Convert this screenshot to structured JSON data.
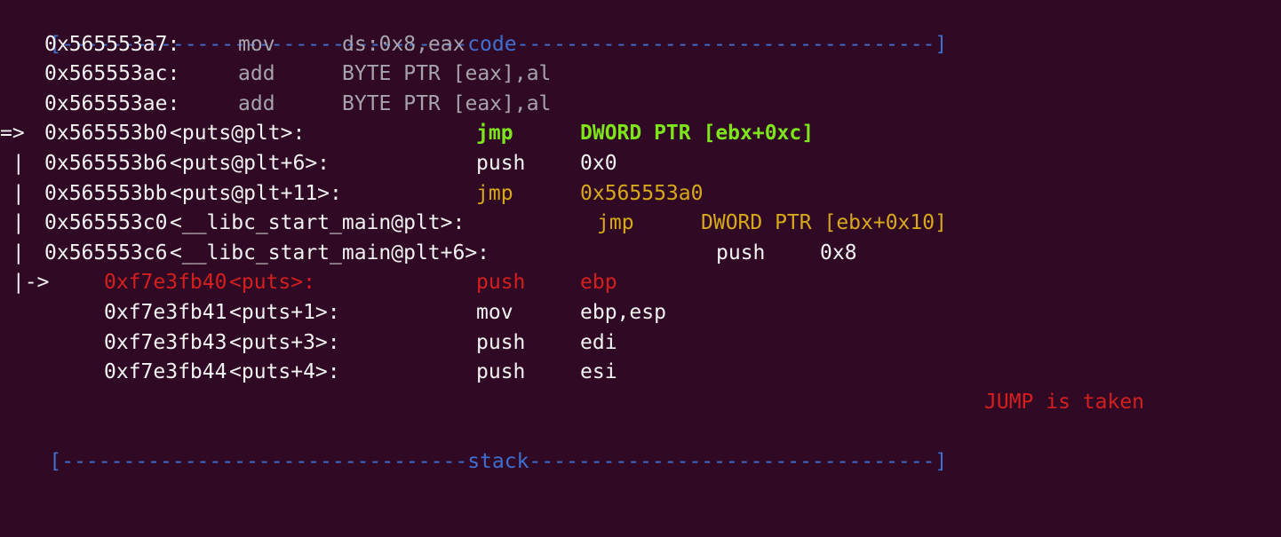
{
  "header": {
    "code_rule": "[---------------------------------code----------------------------------]",
    "stack_rule": "[---------------------------------stack---------------------------------]"
  },
  "prev_lines": [
    {
      "addr": "0x565553a7:",
      "mnemonic": "mov",
      "operands": "ds:0x8,eax"
    },
    {
      "addr": "0x565553ac:",
      "mnemonic": "add",
      "operands": "BYTE PTR [eax],al"
    },
    {
      "addr": "0x565553ae:",
      "mnemonic": "add",
      "operands": "BYTE PTR [eax],al"
    }
  ],
  "current": {
    "marker": "=>",
    "addr": "0x565553b0",
    "symbol": "<puts@plt>:",
    "mnemonic": "jmp",
    "operands": "DWORD PTR [ebx+0xc]"
  },
  "after_lines": [
    {
      "prefix": " |",
      "addr": "0x565553b6",
      "symbol": "<puts@plt+6>:",
      "mnemonic": "push",
      "operands": "0x0"
    },
    {
      "prefix": " |",
      "addr": "0x565553bb",
      "symbol": "<puts@plt+11>:",
      "mnemonic": "jmp",
      "operands": "0x565553a0"
    },
    {
      "prefix": " |",
      "addr": "0x565553c0",
      "symbol": "<__libc_start_main@plt>:",
      "mnemonic": "jmp",
      "operands": "DWORD PTR [ebx+0x10]"
    },
    {
      "prefix": " |",
      "addr": "0x565553c6",
      "symbol": "<__libc_start_main@plt+6>:",
      "mnemonic": "push",
      "operands": "0x8"
    }
  ],
  "target": {
    "prefix": " |->",
    "addr": "0xf7e3fb40",
    "symbol": "<puts>:",
    "mnemonic": "push",
    "operands": "ebp"
  },
  "target_lines": [
    {
      "addr": "0xf7e3fb41",
      "symbol": "<puts+1>:",
      "mnemonic": "mov",
      "operands": "ebp,esp"
    },
    {
      "addr": "0xf7e3fb43",
      "symbol": "<puts+3>:",
      "mnemonic": "push",
      "operands": "edi"
    },
    {
      "addr": "0xf7e3fb44",
      "symbol": "<puts+4>:",
      "mnemonic": "push",
      "operands": "esi"
    }
  ],
  "status": "JUMP is taken",
  "colors": {
    "background": "#300a24",
    "rule": "#3f6fd0",
    "current": "#7ee51a",
    "jump": "#d7a91a",
    "target": "#d51f1f",
    "status": "#d51f1f"
  }
}
